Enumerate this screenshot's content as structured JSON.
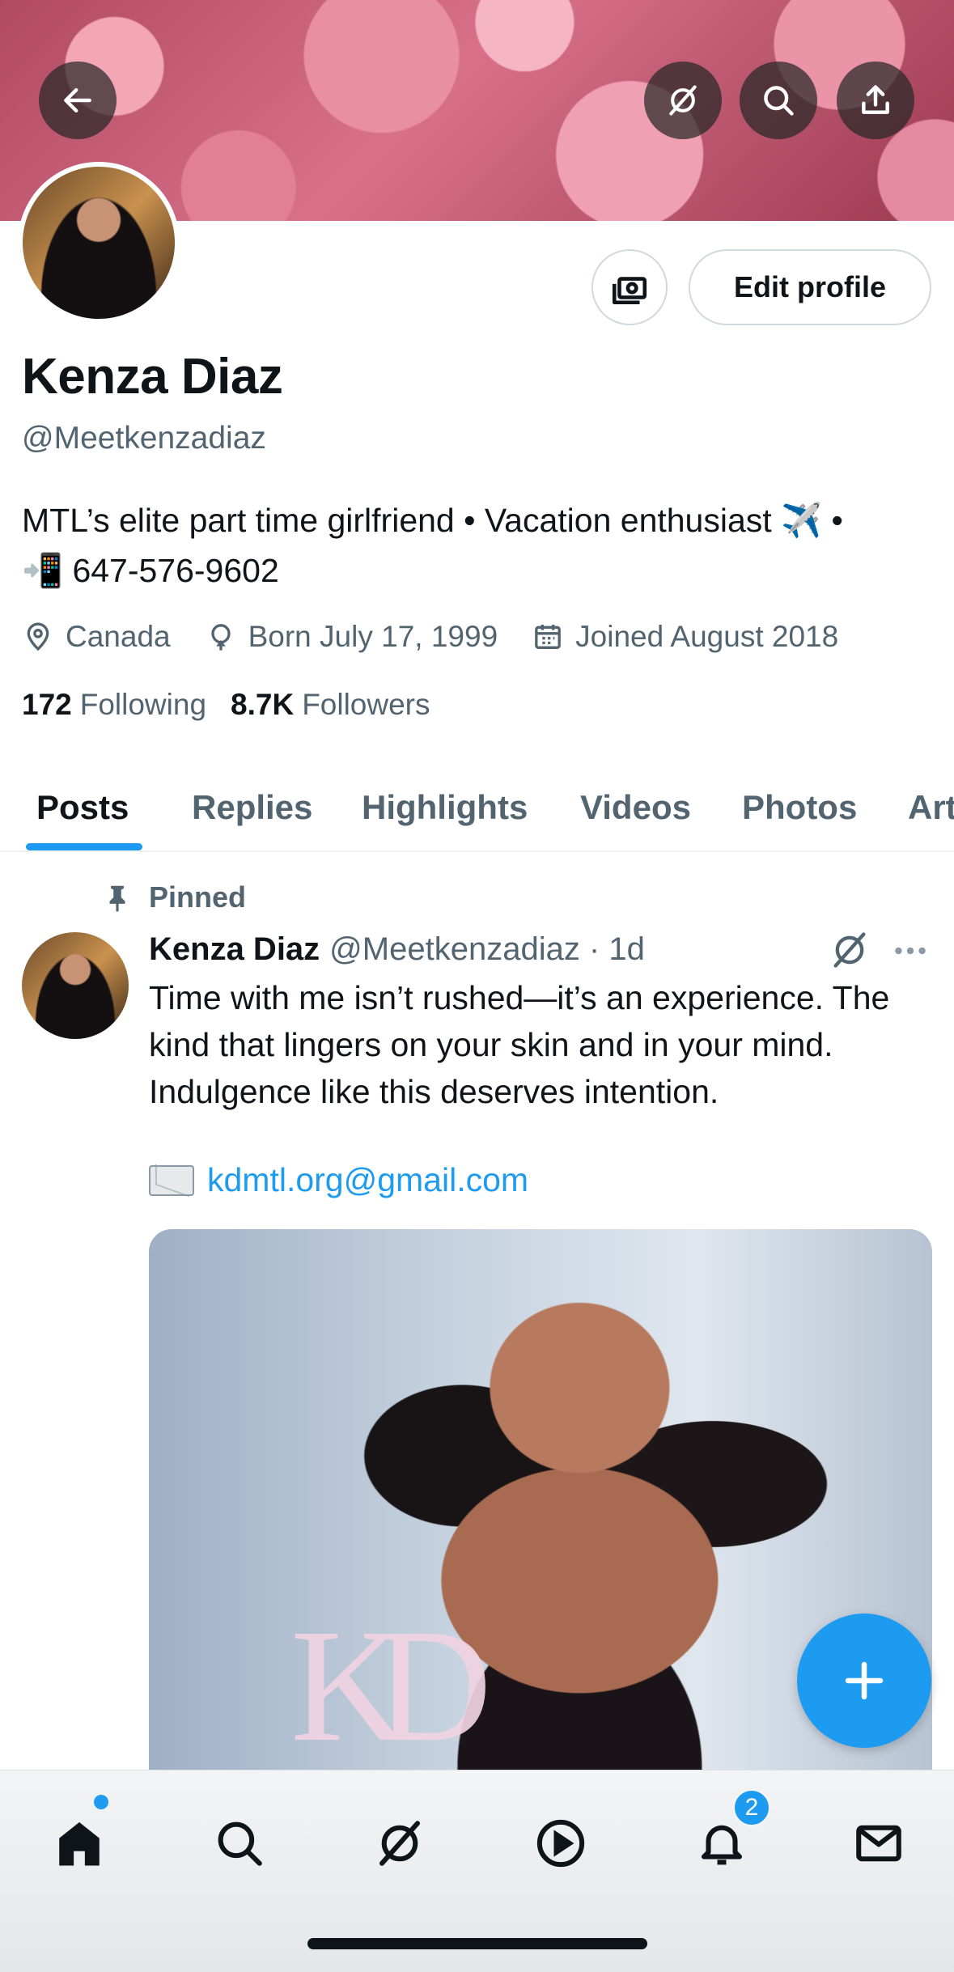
{
  "profile": {
    "name": "Kenza Diaz",
    "handle": "@Meetkenzadiaz",
    "bio_line1": "MTL’s elite part time girlfriend • Vacation enthusiast ✈️ •",
    "bio_line2": "📲 647-576-9602",
    "location": "Canada",
    "born": "Born July 17, 1999",
    "joined": "Joined August 2018",
    "following_count": "172",
    "following_label": "Following",
    "followers_count": "8.7K",
    "followers_label": "Followers",
    "edit_label": "Edit profile"
  },
  "tabs": [
    {
      "label": "Posts",
      "active": true
    },
    {
      "label": "Replies"
    },
    {
      "label": "Highlights"
    },
    {
      "label": "Videos"
    },
    {
      "label": "Photos"
    },
    {
      "label": "Articles"
    }
  ],
  "post": {
    "pinned_label": "Pinned",
    "author": "Kenza Diaz",
    "handle_time": "@Meetkenzadiaz · 1d",
    "text": "Time with me isn’t rushed—it’s an experience. The kind that lingers on your skin and in your mind. Indulgence like this deserves intention.",
    "email": "kdmtl.org@gmail.com",
    "watermark": "KD"
  },
  "nav": {
    "notifications_badge": "2"
  },
  "colors": {
    "accent": "#1d9bf0",
    "text_primary": "#0f1419",
    "text_secondary": "#536471"
  },
  "icons": [
    "back-arrow-icon",
    "grok-icon",
    "search-icon",
    "share-icon",
    "money-icon",
    "location-icon",
    "balloon-icon",
    "calendar-icon",
    "pin-icon",
    "more-icon",
    "plus-icon",
    "home-icon",
    "play-icon",
    "bell-icon",
    "mail-icon"
  ]
}
